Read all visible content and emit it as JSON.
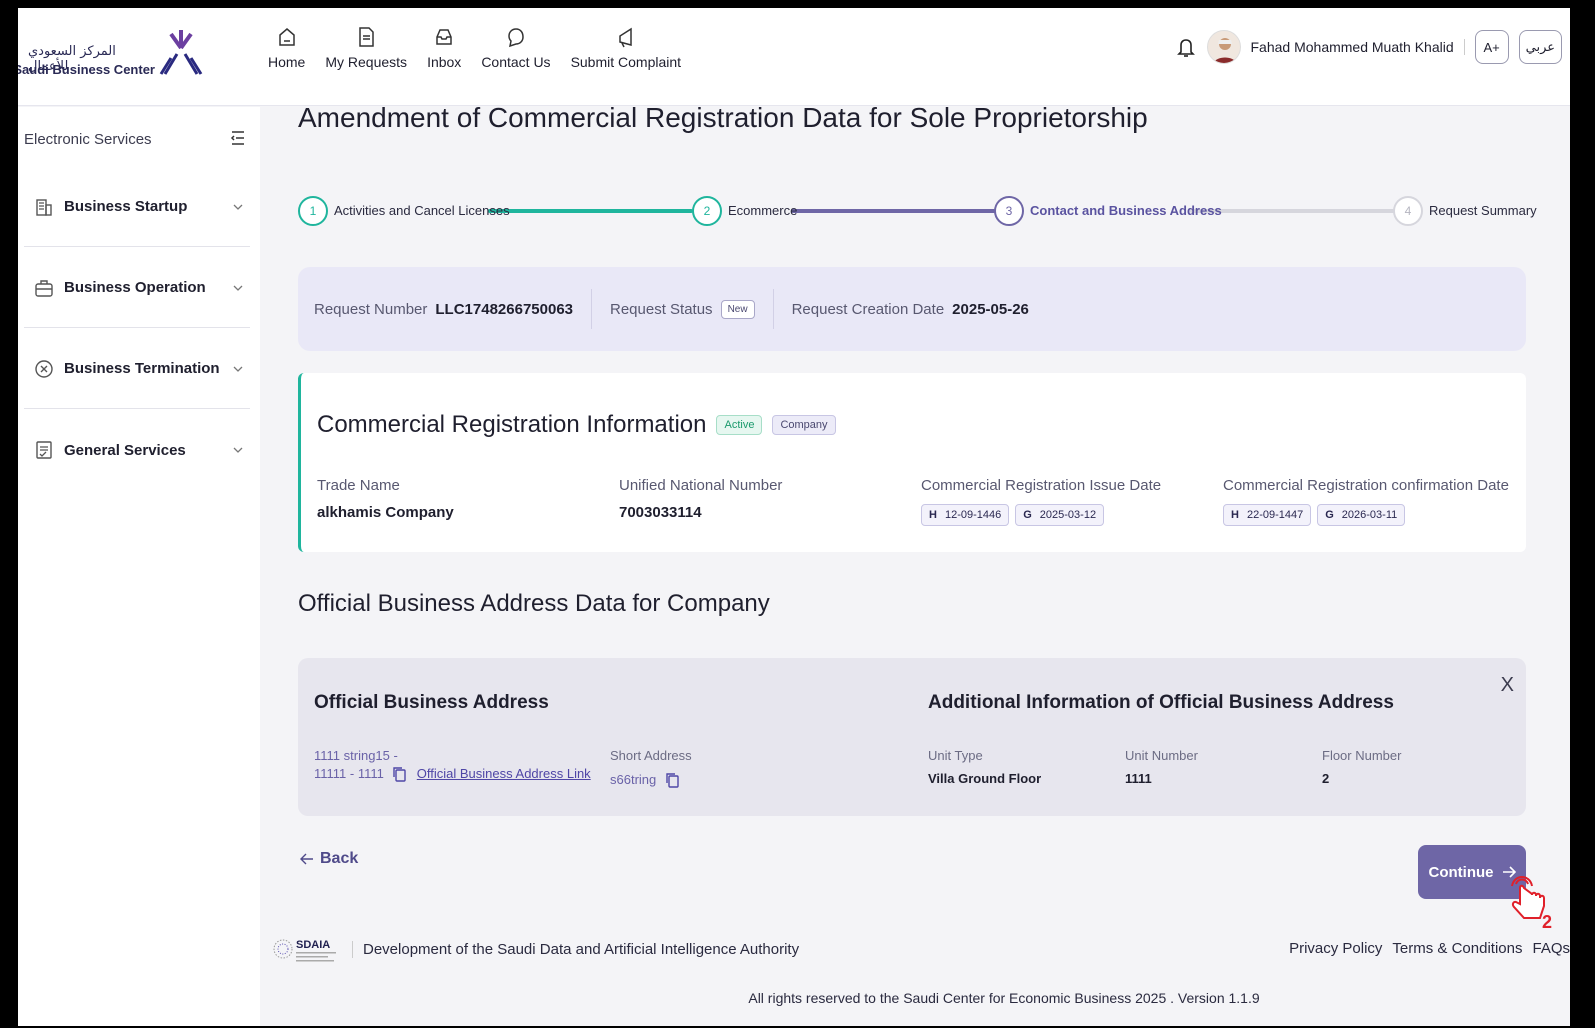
{
  "header": {
    "logo_ar": "المركز السعودي للأعمال",
    "logo_en": "Saudi Business Center",
    "nav": [
      {
        "label": "Home",
        "icon": "home-icon"
      },
      {
        "label": "My Requests",
        "icon": "document-icon"
      },
      {
        "label": "Inbox",
        "icon": "inbox-icon"
      },
      {
        "label": "Contact Us",
        "icon": "chat-icon"
      },
      {
        "label": "Submit Complaint",
        "icon": "megaphone-icon"
      }
    ],
    "user_name": "Fahad Mohammed Muath Khalid",
    "font_size_label": "A+",
    "language_label": "عربي"
  },
  "sidebar": {
    "title": "Electronic Services",
    "items": [
      {
        "label": "Business Startup",
        "icon": "building-icon"
      },
      {
        "label": "Business Operation",
        "icon": "briefcase-icon"
      },
      {
        "label": "Business Termination",
        "icon": "close-circle-icon"
      },
      {
        "label": "General Services",
        "icon": "checklist-icon"
      }
    ]
  },
  "page": {
    "title": "Amendment of Commercial Registration Data for Sole Proprietorship"
  },
  "stepper": {
    "steps": [
      {
        "num": "1",
        "label": "Activities and Cancel Licenses",
        "state": "done"
      },
      {
        "num": "2",
        "label": "Ecommerce",
        "state": "done"
      },
      {
        "num": "3",
        "label": "Contact and Business Address",
        "state": "current"
      },
      {
        "num": "4",
        "label": "Request Summary",
        "state": "pending"
      }
    ]
  },
  "request": {
    "number_label": "Request Number",
    "number": "LLC1748266750063",
    "status_label": "Request Status",
    "status": "New",
    "date_label": "Request Creation Date",
    "date": "2025-05-26"
  },
  "cr": {
    "title": "Commercial Registration Information",
    "badge_active": "Active",
    "badge_company": "Company",
    "trade_name_label": "Trade Name",
    "trade_name": "alkhamis Company",
    "unn_label": "Unified National Number",
    "unn": "7003033114",
    "issue_label": "Commercial Registration Issue Date",
    "issue_h_tag": "H",
    "issue_h": "12-09-1446",
    "issue_g_tag": "G",
    "issue_g": "2025-03-12",
    "confirm_label": "Commercial Registration confirmation Date",
    "confirm_h_tag": "H",
    "confirm_h": "22-09-1447",
    "confirm_g_tag": "G",
    "confirm_g": "2026-03-11"
  },
  "address": {
    "section_title": "Official Business Address Data for Company",
    "official_title": "Official Business Address",
    "addr_line1": "1111 string15 -",
    "addr_line2": "11111 - 1111",
    "addr_link": "Official Business Address Link",
    "short_label": "Short Address",
    "short_value": "s66tring",
    "additional_title": "Additional Information of Official Business Address",
    "unit_type_label": "Unit Type",
    "unit_type": "Villa Ground Floor",
    "unit_number_label": "Unit Number",
    "unit_number": "1111",
    "floor_label": "Floor Number",
    "floor": "2",
    "close_glyph": "X"
  },
  "actions": {
    "back": "Back",
    "continue": "Continue",
    "pointer_step": "2"
  },
  "footer": {
    "sdaia_logo": "SDAIA",
    "sdaia_text": "Development of the Saudi Data and Artificial Intelligence Authority",
    "links": [
      "Privacy Policy",
      "Terms & Conditions",
      "FAQs"
    ],
    "copyright": "All rights reserved to the Saudi Center for Economic Business 2025  .  Version 1.1.9"
  },
  "colors": {
    "accent": "#6e66a6",
    "teal": "#1fb59d",
    "request_bg": "#e9e8f7"
  }
}
